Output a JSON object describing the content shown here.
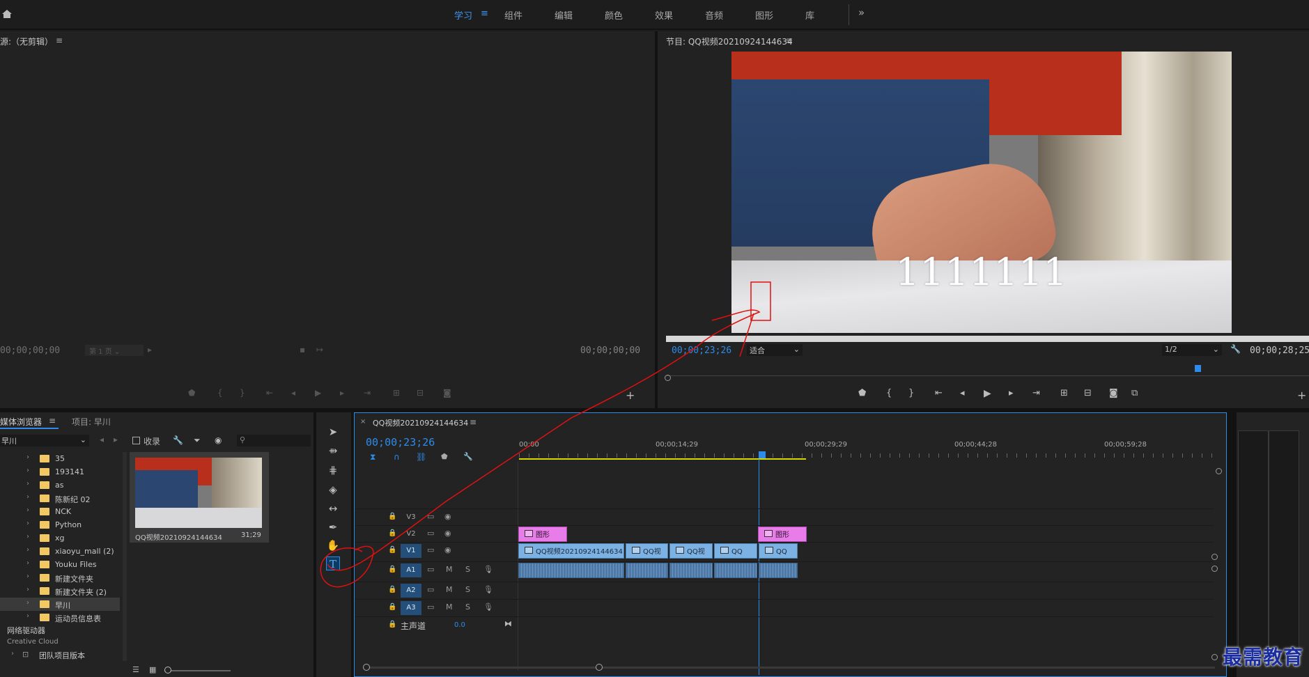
{
  "topbar": {
    "workspaces": [
      "学习",
      "组件",
      "编辑",
      "颜色",
      "效果",
      "音频",
      "图形",
      "库"
    ],
    "active_index": 0,
    "more": "»"
  },
  "source_monitor": {
    "title": "源:（无剪辑）",
    "timecode_left": "00;00;00;00",
    "page_select": "第 1 页",
    "timecode_right": "00;00;00;00"
  },
  "program_monitor": {
    "title": "节目: QQ视频20210924144634",
    "overlay_text": "1111111",
    "timecode_current": "00;00;23;26",
    "fit_select": "适合",
    "resolution_select": "1/2",
    "timecode_duration": "00;00;28;25"
  },
  "media_browser": {
    "tab_browser": "媒体浏览器",
    "tab_project": "项目: 早川",
    "location_select": "早川",
    "ingest_label": "收录",
    "tree": [
      {
        "label": "35"
      },
      {
        "label": "193141"
      },
      {
        "label": "as"
      },
      {
        "label": "陈新纪 02"
      },
      {
        "label": "NCK"
      },
      {
        "label": "Python"
      },
      {
        "label": "xg"
      },
      {
        "label": "xiaoyu_mall (2)"
      },
      {
        "label": "Youku Files"
      },
      {
        "label": "新建文件夹"
      },
      {
        "label": "新建文件夹 (2)"
      },
      {
        "label": "早川"
      },
      {
        "label": "运动员信息表"
      }
    ],
    "network_drives": "网络驱动器",
    "creative_cloud": "Creative Cloud",
    "team_versions": "团队项目版本",
    "thumb_name": "QQ视频20210924144634",
    "thumb_duration": "31;29"
  },
  "timeline": {
    "tab_title": "QQ视频20210924144634",
    "timecode": "00;00;23;26",
    "ruler": [
      "00;00",
      "00;00;14;29",
      "00;00;29;29",
      "00;00;44;28",
      "00;00;59;28"
    ],
    "tracks": {
      "v3": "V3",
      "v2": "V2",
      "v1": "V1",
      "a1": "A1",
      "a2": "A2",
      "a3": "A3",
      "mute": "M",
      "solo": "S"
    },
    "master_label": "主声道",
    "master_value": "0.0",
    "graphics_clip": "图形",
    "video_clips": [
      "QQ视频20210924144634.m",
      "QQ视",
      "QQ视",
      "QQ",
      "QQ"
    ]
  },
  "watermark": "最需教育",
  "colors": {
    "accent": "#2d8ceb",
    "playhead": "#2d8ceb",
    "annotation": "#e01010",
    "graphics_clip": "#e87ce8",
    "video_clip": "#7cb1e3",
    "audio_clip": "#4e79a6",
    "folder": "#f2c862"
  }
}
